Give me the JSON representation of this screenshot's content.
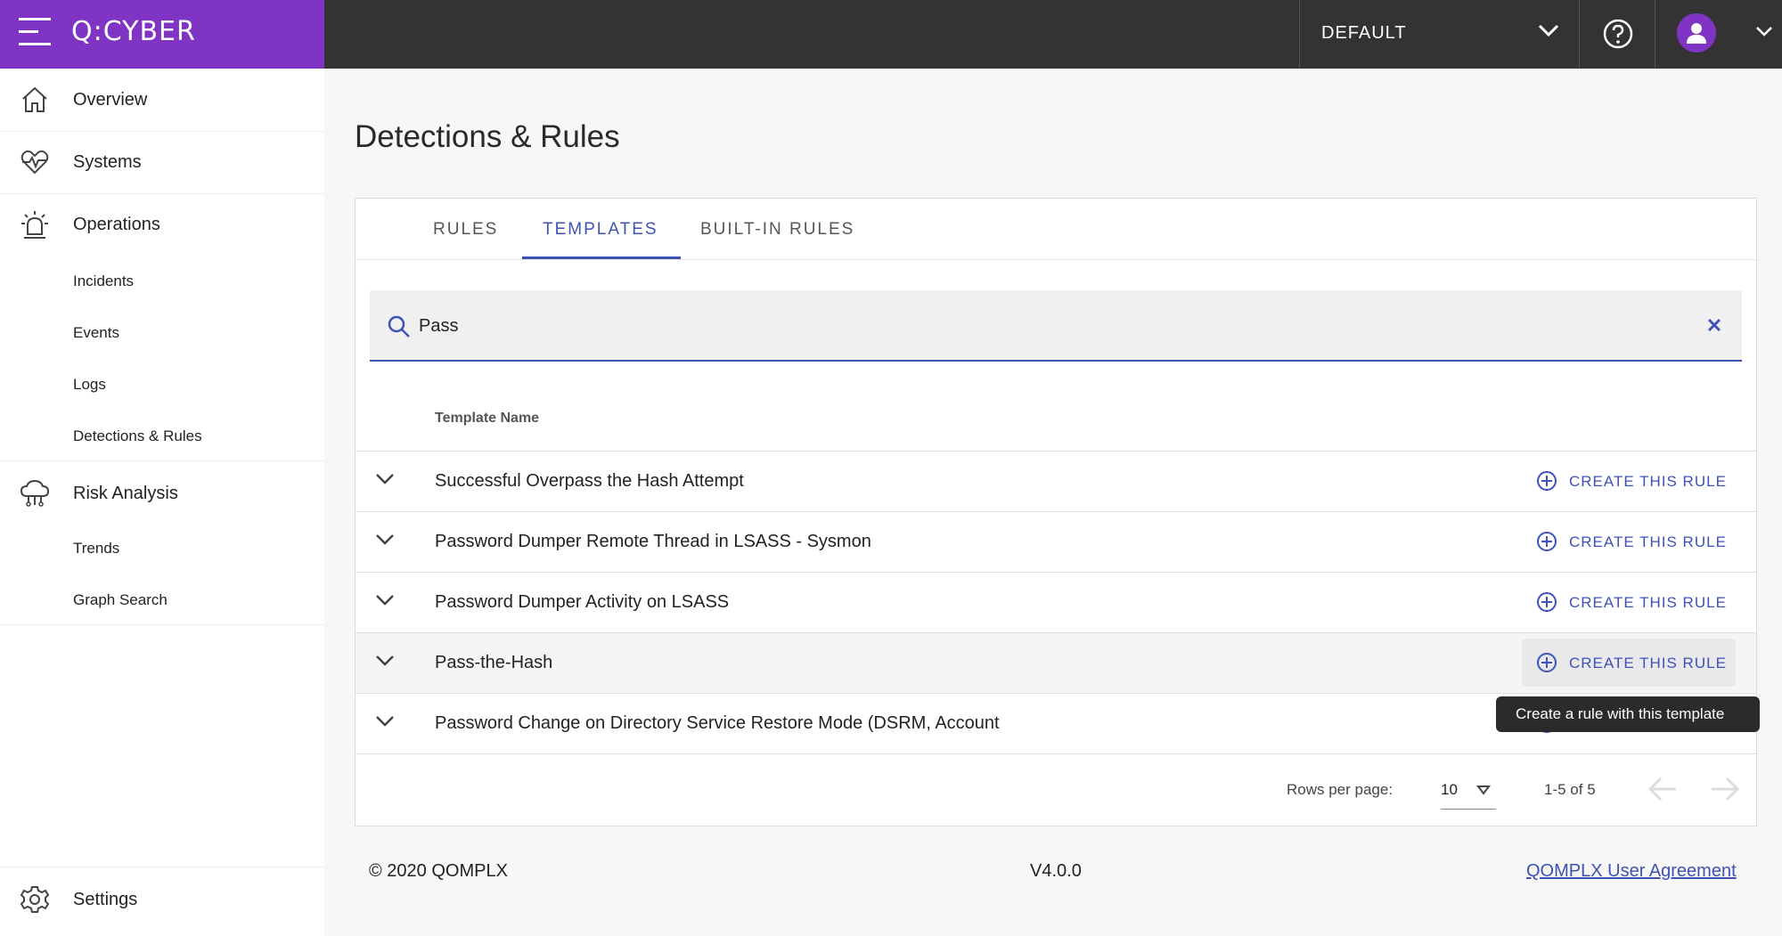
{
  "header": {
    "logo": "Q:CYBER",
    "tenant": "DEFAULT"
  },
  "sidebar": {
    "overview": "Overview",
    "systems": "Systems",
    "operations": "Operations",
    "operations_items": [
      "Incidents",
      "Events",
      "Logs",
      "Detections & Rules"
    ],
    "risk_analysis": "Risk Analysis",
    "risk_items": [
      "Trends",
      "Graph Search"
    ],
    "settings": "Settings"
  },
  "page": {
    "title": "Detections & Rules"
  },
  "tabs": [
    "RULES",
    "TEMPLATES",
    "BUILT-IN RULES"
  ],
  "active_tab": "TEMPLATES",
  "search": {
    "value": "Pass"
  },
  "table": {
    "column": "Template Name",
    "action_label": "CREATE THIS RULE",
    "rows": [
      "Successful Overpass the Hash Attempt",
      "Password Dumper Remote Thread in LSASS - Sysmon",
      "Password Dumper Activity on LSASS",
      "Pass-the-Hash",
      "Password Change on Directory Service Restore Mode (DSRM, Account"
    ]
  },
  "pagination": {
    "rows_per_page_label": "Rows per page:",
    "rows_per_page": "10",
    "range": "1-5 of 5"
  },
  "tooltip": "Create a rule with this template",
  "footer": {
    "copyright": "© 2020 QOMPLX",
    "version": "V4.0.0",
    "agreement": "QOMPLX User Agreement"
  },
  "colors": {
    "brand": "#8034c4",
    "accent": "#3f51b5",
    "topbar": "#333333"
  }
}
